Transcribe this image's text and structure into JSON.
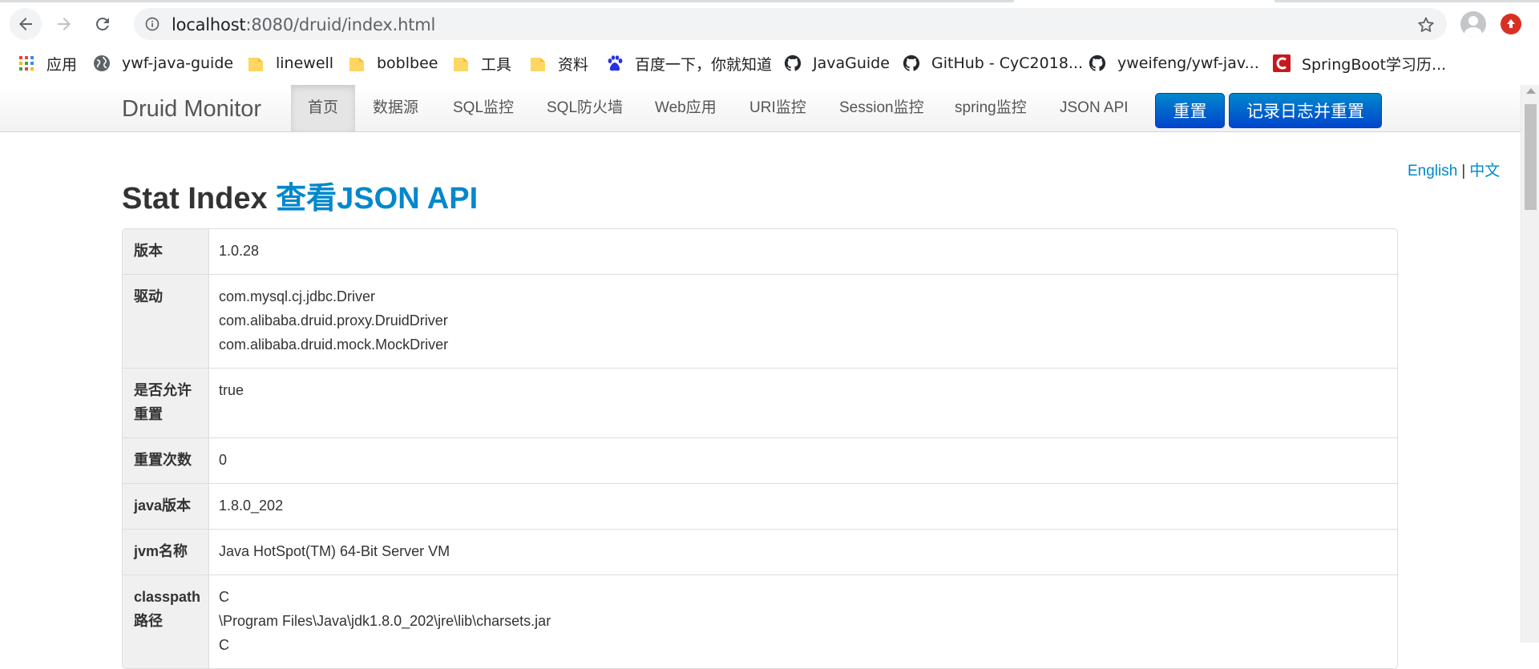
{
  "browser": {
    "url_host": "localhost",
    "url_rest": ":8080/druid/index.html"
  },
  "bookmarks": [
    {
      "label": "应用",
      "icon": "apps-grid-icon"
    },
    {
      "label": "ywf-java-guide",
      "icon": "globe-icon"
    },
    {
      "label": "linewell",
      "icon": "folder-icon"
    },
    {
      "label": "boblbee",
      "icon": "folder-icon"
    },
    {
      "label": "工具",
      "icon": "folder-icon"
    },
    {
      "label": "资料",
      "icon": "folder-icon"
    },
    {
      "label": "百度一下，你就知道",
      "icon": "baidu-icon"
    },
    {
      "label": "JavaGuide",
      "icon": "github-icon"
    },
    {
      "label": "GitHub - CyC2018...",
      "icon": "github-icon"
    },
    {
      "label": "yweifeng/ywf-jav...",
      "icon": "github-icon"
    },
    {
      "label": "SpringBoot学习历...",
      "icon": "csdn-icon"
    }
  ],
  "navbar": {
    "brand": "Druid Monitor",
    "items": [
      "首页",
      "数据源",
      "SQL监控",
      "SQL防火墙",
      "Web应用",
      "URI监控",
      "Session监控",
      "spring监控",
      "JSON API"
    ],
    "reset_button": "重置",
    "log_reset_button": "记录日志并重置"
  },
  "lang": {
    "english": "English",
    "sep": "|",
    "chinese": "中文"
  },
  "page": {
    "title": "Stat Index",
    "json_link": "查看JSON API"
  },
  "stats": [
    {
      "key": [
        "版本"
      ],
      "values": [
        "1.0.28"
      ]
    },
    {
      "key": [
        "驱动"
      ],
      "values": [
        "com.mysql.cj.jdbc.Driver",
        "com.alibaba.druid.proxy.DruidDriver",
        "com.alibaba.druid.mock.MockDriver"
      ]
    },
    {
      "key": [
        "是否允许",
        "重置"
      ],
      "values": [
        "true"
      ]
    },
    {
      "key": [
        "重置次数"
      ],
      "values": [
        "0"
      ]
    },
    {
      "key": [
        "java版本"
      ],
      "values": [
        "1.8.0_202"
      ]
    },
    {
      "key": [
        "jvm名称"
      ],
      "values": [
        "Java HotSpot(TM) 64-Bit Server VM"
      ]
    },
    {
      "key": [
        "classpath",
        "路径"
      ],
      "values": [
        "C",
        "\\Program Files\\Java\\jdk1.8.0_202\\jre\\lib\\charsets.jar",
        "C"
      ]
    }
  ],
  "colors": {
    "link": "#0088cc",
    "button": "#0055cc",
    "update": "#d93025"
  }
}
